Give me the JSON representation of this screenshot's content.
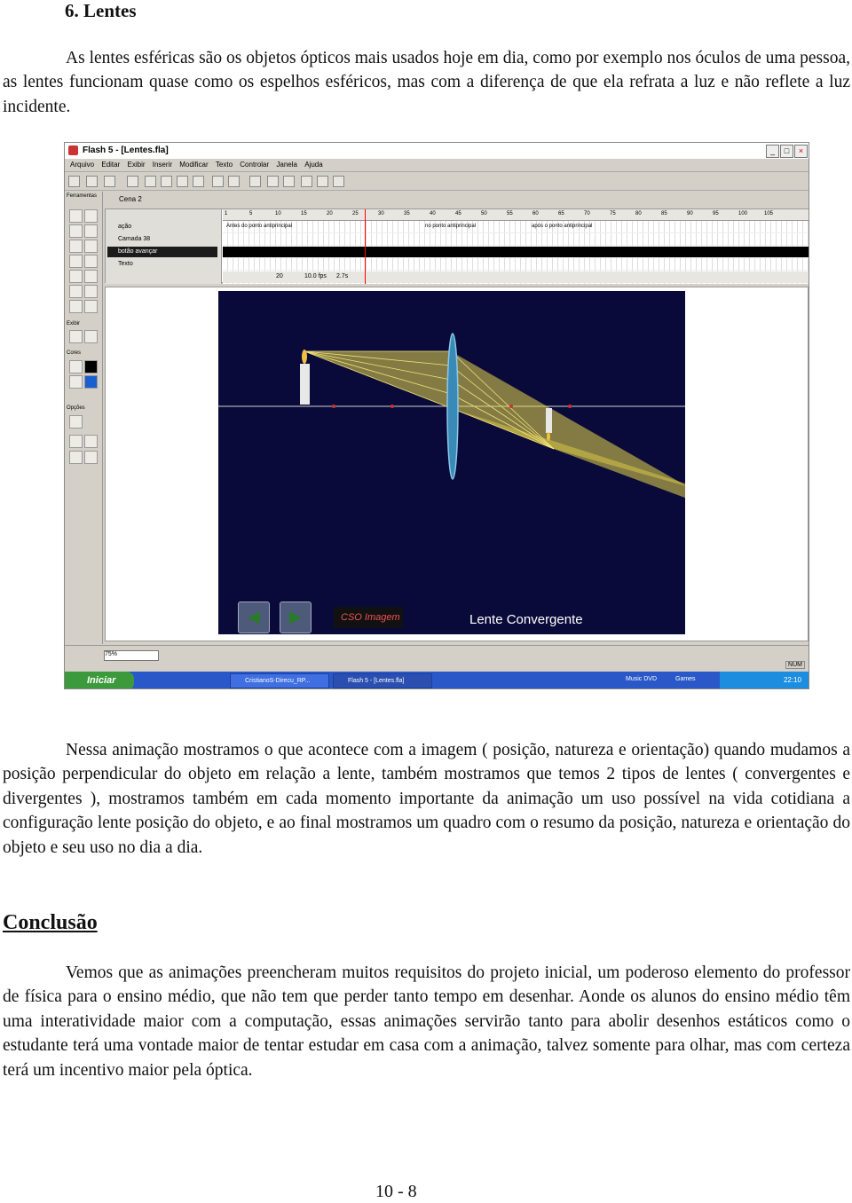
{
  "heading": "6. Lentes",
  "intro": "As lentes esféricas são os objetos ópticos mais usados hoje em dia, como por exemplo nos óculos de uma pessoa, as lentes funcionam quase como os espelhos esféricos, mas com a diferença de que ela refrata a luz e não reflete a luz incidente.",
  "screenshot": {
    "title": "Flash 5 - [Lentes.fla]",
    "menu": [
      "Arquivo",
      "Editar",
      "Exibir",
      "Inserir",
      "Modificar",
      "Texto",
      "Controlar",
      "Janela",
      "Ajuda"
    ],
    "panel_title": "Ferramentas",
    "panel_labels": {
      "view": "Exibir",
      "colors": "Cores",
      "options": "Opções"
    },
    "scene": "Cena 2",
    "layers": [
      "ação",
      "Camada 38",
      "botão avançar",
      "Texto"
    ],
    "ruler": [
      "1",
      "5",
      "10",
      "15",
      "20",
      "25",
      "30",
      "35",
      "40",
      "45",
      "50",
      "55",
      "60",
      "65",
      "70",
      "75",
      "80",
      "85",
      "90",
      "95",
      "100",
      "105"
    ],
    "frame_labels": [
      "Antes do ponto antiprincipal",
      "no ponto antiprincipal",
      "após o ponto antiprincipal"
    ],
    "frame_info": {
      "frame": "20",
      "fps": "10.0 fps",
      "time": "2.7s"
    },
    "stage_caption": "Lente Convergente",
    "logo_text": "CSO Imagem",
    "zoom": "75%",
    "num": "NUM",
    "start": "Iniciar",
    "tasks": [
      "CristianoS-Direcu_RP...",
      "Flash 5 - [Lentes.fla]"
    ],
    "tray_items": [
      "Music DVD",
      "Games"
    ],
    "clock": "22:10",
    "colors": {
      "stage": "#0a0a3a",
      "rays": "#e8d84a",
      "lens": "#3a8ab8"
    }
  },
  "para2": "Nessa animação mostramos o que acontece com a imagem ( posição, natureza e orientação) quando mudamos a posição perpendicular do objeto em relação a lente, também mostramos que temos 2 tipos de lentes ( convergentes e divergentes ), mostramos também em cada momento importante da animação um uso possível na vida cotidiana a configuração lente posição do objeto, e ao final mostramos um quadro com o resumo da  posição, natureza e orientação do objeto e seu uso no dia a dia.",
  "conclusion_heading": "Conclusão",
  "conclusion": "Vemos que as animações preencheram muitos requisitos do projeto inicial, um poderoso elemento do professor de física para o ensino médio, que não tem que perder tanto tempo em desenhar. Aonde os alunos do ensino médio têm uma interatividade maior com a computação, essas animações servirão tanto para abolir desenhos estáticos como o estudante terá uma vontade maior de tentar estudar em casa com a animação, talvez somente para olhar, mas com certeza terá um incentivo maior pela óptica.",
  "page_number": "10 -  8"
}
